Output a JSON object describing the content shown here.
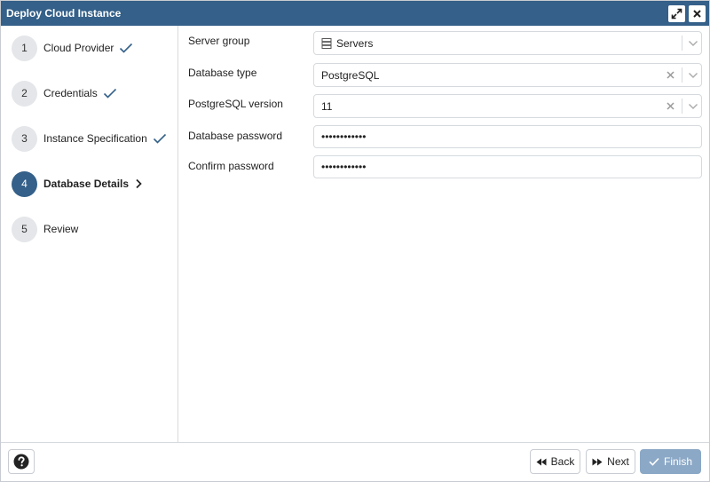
{
  "window": {
    "title": "Deploy Cloud Instance"
  },
  "titlebar_buttons": {
    "maximize": "expand-icon",
    "close": "close-icon"
  },
  "steps": [
    {
      "number": "1",
      "label": "Cloud Provider",
      "status": "complete"
    },
    {
      "number": "2",
      "label": "Credentials",
      "status": "complete"
    },
    {
      "number": "3",
      "label": "Instance Specification",
      "status": "complete"
    },
    {
      "number": "4",
      "label": "Database Details",
      "status": "active"
    },
    {
      "number": "5",
      "label": "Review",
      "status": "pending"
    }
  ],
  "form": {
    "server_group": {
      "label": "Server group",
      "value": "Servers",
      "icon": "server-group-icon"
    },
    "database_type": {
      "label": "Database type",
      "value": "PostgreSQL"
    },
    "postgres_version": {
      "label": "PostgreSQL version",
      "value": "11"
    },
    "database_password": {
      "label": "Database password",
      "value": "••••••••••••"
    },
    "confirm_password": {
      "label": "Confirm password",
      "value": "••••••••••••"
    }
  },
  "footer": {
    "help_icon": "question-icon",
    "back_label": "Back",
    "next_label": "Next",
    "finish_label": "Finish"
  },
  "colors": {
    "titlebar": "#346089",
    "active_step": "#346089",
    "check": "#346089",
    "finish_disabled": "#8ba8c6"
  }
}
